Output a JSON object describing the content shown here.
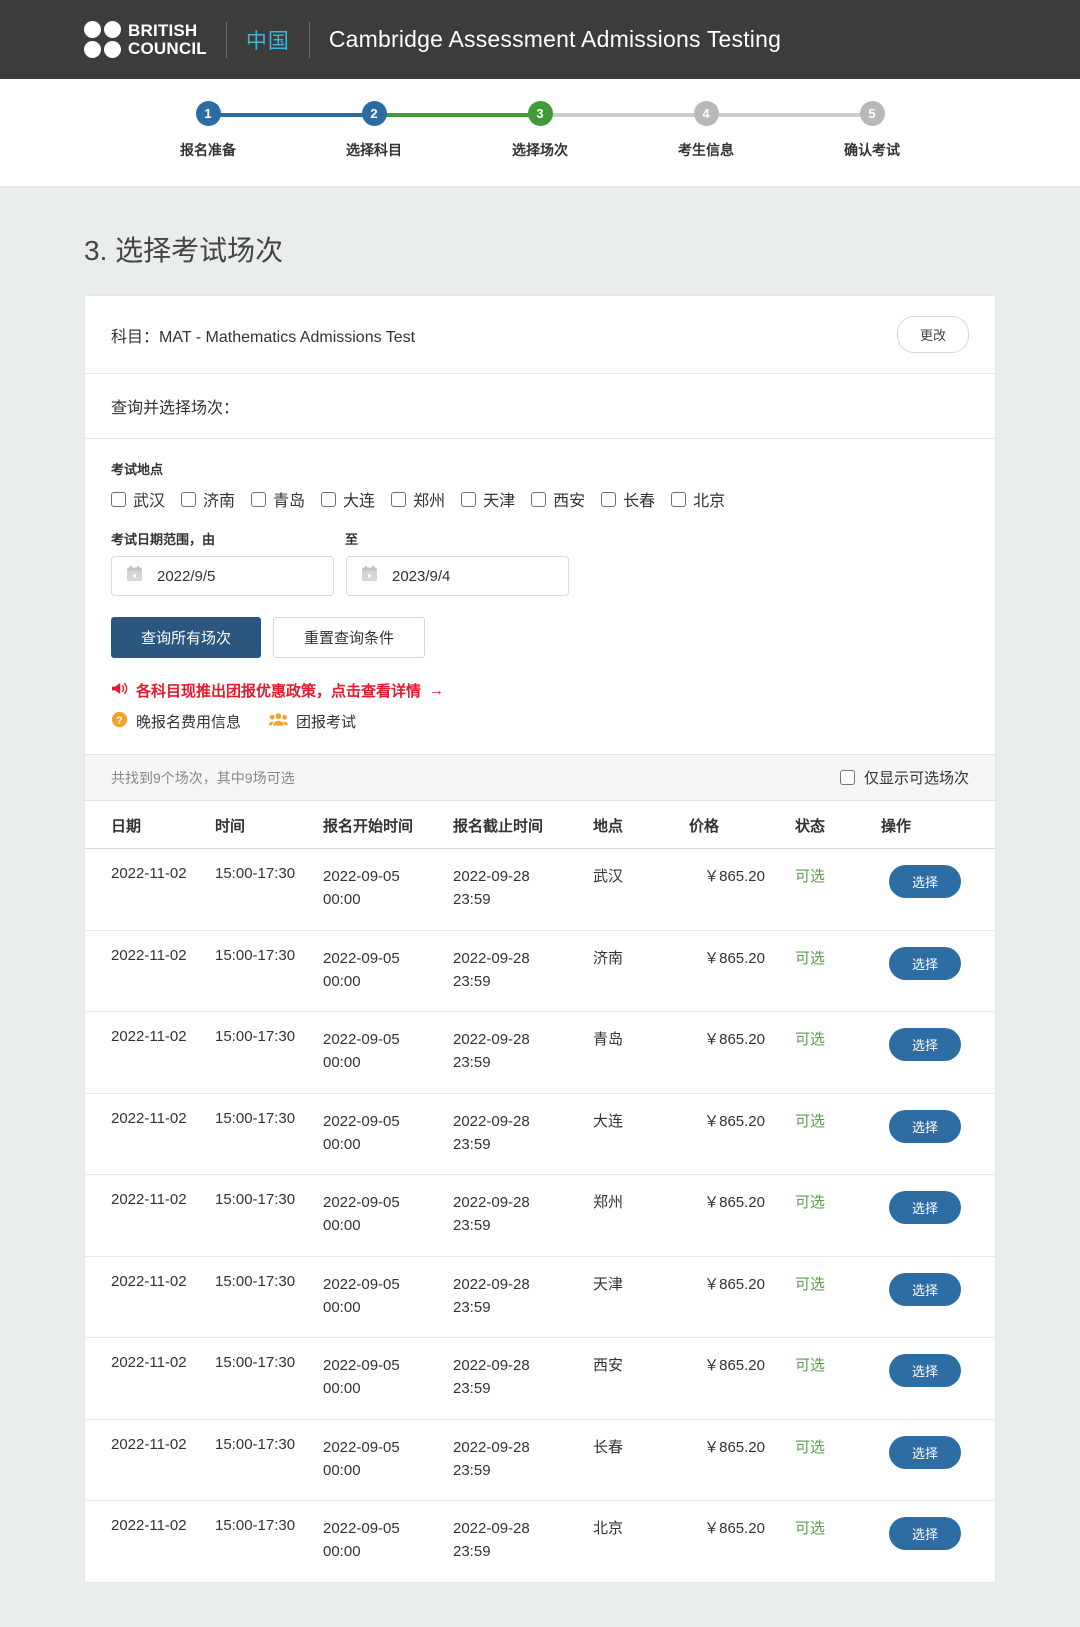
{
  "header": {
    "brand_line1": "BRITISH",
    "brand_line2": "COUNCIL",
    "locale": "中国",
    "title": "Cambridge Assessment Admissions Testing",
    "brand_bg": "#3c3c3b",
    "locale_color": "#3ab6e3"
  },
  "stepper": {
    "steps": [
      {
        "num": "1",
        "label": "报名准备",
        "state": "done",
        "color": "#2d6ca2"
      },
      {
        "num": "2",
        "label": "选择科目",
        "state": "done",
        "color": "#2d6ca2"
      },
      {
        "num": "3",
        "label": "选择场次",
        "state": "current",
        "color": "#3f9c35"
      },
      {
        "num": "4",
        "label": "考生信息",
        "state": "todo",
        "color": "#b8b8b8"
      },
      {
        "num": "5",
        "label": "确认考试",
        "state": "todo",
        "color": "#b8b8b8"
      }
    ]
  },
  "page": {
    "title": "3. 选择考试场次"
  },
  "subject": {
    "label": "科目：",
    "value": "MAT - Mathematics Admissions Test",
    "change_button": "更改"
  },
  "query": {
    "heading": "查询并选择场次："
  },
  "filters": {
    "location_label": "考试地点",
    "cities": [
      {
        "name": "武汉",
        "checked": false
      },
      {
        "name": "济南",
        "checked": false
      },
      {
        "name": "青岛",
        "checked": false
      },
      {
        "name": "大连",
        "checked": false
      },
      {
        "name": "郑州",
        "checked": false
      },
      {
        "name": "天津",
        "checked": false
      },
      {
        "name": "西安",
        "checked": false
      },
      {
        "name": "长春",
        "checked": false
      },
      {
        "name": "北京",
        "checked": false
      }
    ],
    "date_from_label": "考试日期范围，由",
    "date_to_label": "至",
    "date_from_value": "2022/9/5",
    "date_to_value": "2023/9/4",
    "search_button": "查询所有场次",
    "reset_button": "重置查询条件",
    "promo_text": "各科目现推出团报优惠政策，点击查看详情",
    "promo_arrow": "→",
    "promo_color": "#e8192c",
    "link_late_fee": "晚报名费用信息",
    "link_group": "团报考试"
  },
  "results": {
    "count_text": "共找到9个场次，其中9场可选",
    "only_available_label": "仅显示可选场次",
    "only_available_checked": false,
    "columns": [
      "日期",
      "时间",
      "报名开始时间",
      "报名截止时间",
      "地点",
      "价格",
      "状态",
      "操作"
    ],
    "action_label": "选择",
    "status_color": "#5b9d4e",
    "rows": [
      {
        "date": "2022-11-02",
        "time": "15:00-17:30",
        "start_date": "2022-09-05",
        "start_time": "00:00",
        "end_date": "2022-09-28",
        "end_time": "23:59",
        "location": "武汉",
        "price": "￥865.20",
        "status": "可选",
        "action": "选择"
      },
      {
        "date": "2022-11-02",
        "time": "15:00-17:30",
        "start_date": "2022-09-05",
        "start_time": "00:00",
        "end_date": "2022-09-28",
        "end_time": "23:59",
        "location": "济南",
        "price": "￥865.20",
        "status": "可选",
        "action": "选择"
      },
      {
        "date": "2022-11-02",
        "time": "15:00-17:30",
        "start_date": "2022-09-05",
        "start_time": "00:00",
        "end_date": "2022-09-28",
        "end_time": "23:59",
        "location": "青岛",
        "price": "￥865.20",
        "status": "可选",
        "action": "选择"
      },
      {
        "date": "2022-11-02",
        "time": "15:00-17:30",
        "start_date": "2022-09-05",
        "start_time": "00:00",
        "end_date": "2022-09-28",
        "end_time": "23:59",
        "location": "大连",
        "price": "￥865.20",
        "status": "可选",
        "action": "选择"
      },
      {
        "date": "2022-11-02",
        "time": "15:00-17:30",
        "start_date": "2022-09-05",
        "start_time": "00:00",
        "end_date": "2022-09-28",
        "end_time": "23:59",
        "location": "郑州",
        "price": "￥865.20",
        "status": "可选",
        "action": "选择"
      },
      {
        "date": "2022-11-02",
        "time": "15:00-17:30",
        "start_date": "2022-09-05",
        "start_time": "00:00",
        "end_date": "2022-09-28",
        "end_time": "23:59",
        "location": "天津",
        "price": "￥865.20",
        "status": "可选",
        "action": "选择"
      },
      {
        "date": "2022-11-02",
        "time": "15:00-17:30",
        "start_date": "2022-09-05",
        "start_time": "00:00",
        "end_date": "2022-09-28",
        "end_time": "23:59",
        "location": "西安",
        "price": "￥865.20",
        "status": "可选",
        "action": "选择"
      },
      {
        "date": "2022-11-02",
        "time": "15:00-17:30",
        "start_date": "2022-09-05",
        "start_time": "00:00",
        "end_date": "2022-09-28",
        "end_time": "23:59",
        "location": "长春",
        "price": "￥865.20",
        "status": "可选",
        "action": "选择"
      },
      {
        "date": "2022-11-02",
        "time": "15:00-17:30",
        "start_date": "2022-09-05",
        "start_time": "00:00",
        "end_date": "2022-09-28",
        "end_time": "23:59",
        "location": "北京",
        "price": "￥865.20",
        "status": "可选",
        "action": "选择"
      }
    ]
  }
}
